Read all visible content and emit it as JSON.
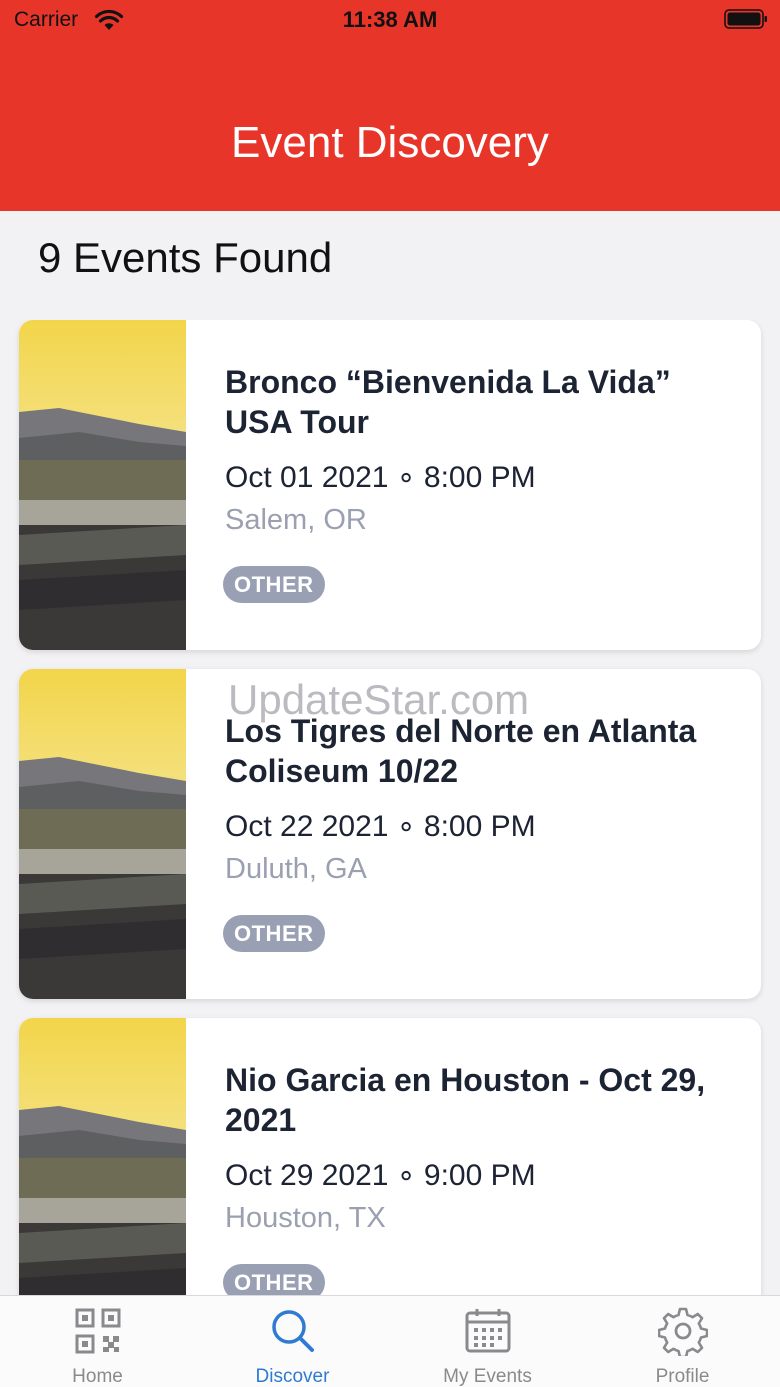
{
  "status": {
    "carrier": "Carrier",
    "time": "11:38 AM"
  },
  "header": {
    "title": "Event Discovery"
  },
  "results": {
    "count_label": "9 Events Found"
  },
  "events": [
    {
      "title": "Bronco “Bienvenida La Vida” USA Tour",
      "date": "Oct 01 2021 ∘ 8:00 PM",
      "location": "Salem, OR",
      "tag": "OTHER"
    },
    {
      "title": "Los Tigres del Norte en Atlanta Coliseum 10/22",
      "date": "Oct 22 2021 ∘ 8:00 PM",
      "location": "Duluth, GA",
      "tag": "OTHER"
    },
    {
      "title": "Nio Garcia en Houston - Oct 29, 2021",
      "date": "Oct 29 2021 ∘ 9:00 PM",
      "location": "Houston, TX",
      "tag": "OTHER"
    }
  ],
  "watermark": "UpdateStar.com",
  "tabbar": {
    "tabs": [
      {
        "label": "Home",
        "icon": "qr-code-icon"
      },
      {
        "label": "Discover",
        "icon": "search-icon",
        "active": true
      },
      {
        "label": "My Events",
        "icon": "calendar-icon"
      },
      {
        "label": "Profile",
        "icon": "gear-icon"
      }
    ]
  },
  "colors": {
    "header": "#e8352a",
    "accent": "#2f7bd2",
    "tag": "#9aa0b4"
  }
}
